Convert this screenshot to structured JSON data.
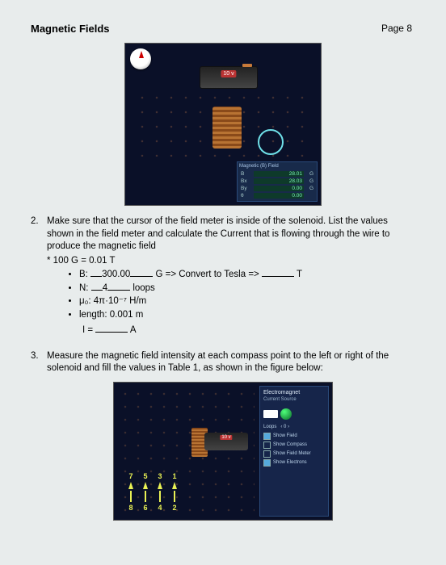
{
  "header": {
    "title": "Magnetic Fields",
    "page_label": "Page 8"
  },
  "sim1": {
    "battery_label": "10 v",
    "readout_title": "Magnetic (B) Field",
    "rows": [
      {
        "label": "B",
        "value": "28.01",
        "unit": "G"
      },
      {
        "label": "Bx",
        "value": "28.03",
        "unit": "G"
      },
      {
        "label": "By",
        "value": "0.00",
        "unit": "G"
      },
      {
        "label": "θ",
        "value": "0.00",
        "unit": ""
      }
    ]
  },
  "q2": {
    "number": "2.",
    "text": "Make sure that the cursor of the field meter is inside of the solenoid. List the values shown in the field meter and calculate the Current that is flowing through the wire to produce the magnetic field",
    "note": "* 100 G = 0.01 T",
    "bullets": {
      "b_prefix": "B:",
      "b_value": "300.00",
      "b_unit": "G => Convert to Tesla =>",
      "b_tail_unit": "T",
      "n_prefix": "N:",
      "n_value": "4",
      "n_tail": "loops",
      "mu_line": "μ₀: 4π·10⁻⁷ H/m",
      "len_line": "length: 0.001 m"
    },
    "answer_prefix": "I =",
    "answer_unit": "A"
  },
  "q3": {
    "number": "3.",
    "text": "Measure the magnetic field intensity at each compass point to the left or right of the solenoid and fill the values in Table 1, as shown in the figure below:"
  },
  "sim2": {
    "panel_title": "Electromagnet",
    "panel_sub": "Current Source",
    "loops_label": "Loops",
    "loops_controls": [
      "‹",
      "0",
      "›"
    ],
    "battery_label": "10 v",
    "options": [
      {
        "checked": true,
        "label": "Show Field"
      },
      {
        "checked": false,
        "label": "Show Compass"
      },
      {
        "checked": false,
        "label": "Show Field Meter"
      },
      {
        "checked": true,
        "label": "Show Electrons"
      }
    ],
    "points_top": [
      "7",
      "5",
      "3",
      "1"
    ],
    "points_bottom": [
      "8",
      "6",
      "4",
      "2"
    ]
  }
}
